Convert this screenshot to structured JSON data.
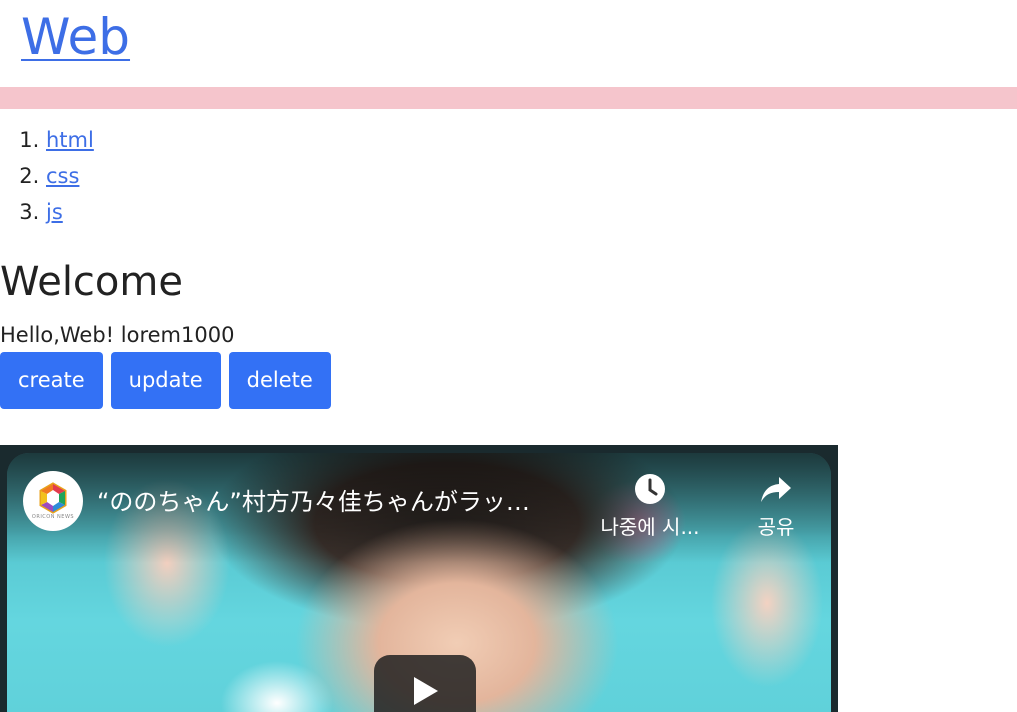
{
  "site": {
    "title": "Web"
  },
  "nav": {
    "items": [
      {
        "label": "html"
      },
      {
        "label": "css"
      },
      {
        "label": "js"
      }
    ]
  },
  "main": {
    "heading": "Welcome",
    "body": "Hello,Web! lorem1000"
  },
  "buttons": {
    "create": "create",
    "update": "update",
    "delete": "delete"
  },
  "video": {
    "title": "“ののちゃん”村方乃々佳ちゃんがラッ…",
    "channel": "ORICON NEWS",
    "watch_later": "나중에 시...",
    "share": "공유"
  },
  "colors": {
    "link": "#3d6ee6",
    "button": "#3371f5",
    "divider": "#f5c5cc"
  },
  "icons": {
    "watch_later": "clock-icon",
    "share": "share-arrow-icon",
    "play": "play-icon",
    "channel_logo": "oricon-logo-icon"
  }
}
